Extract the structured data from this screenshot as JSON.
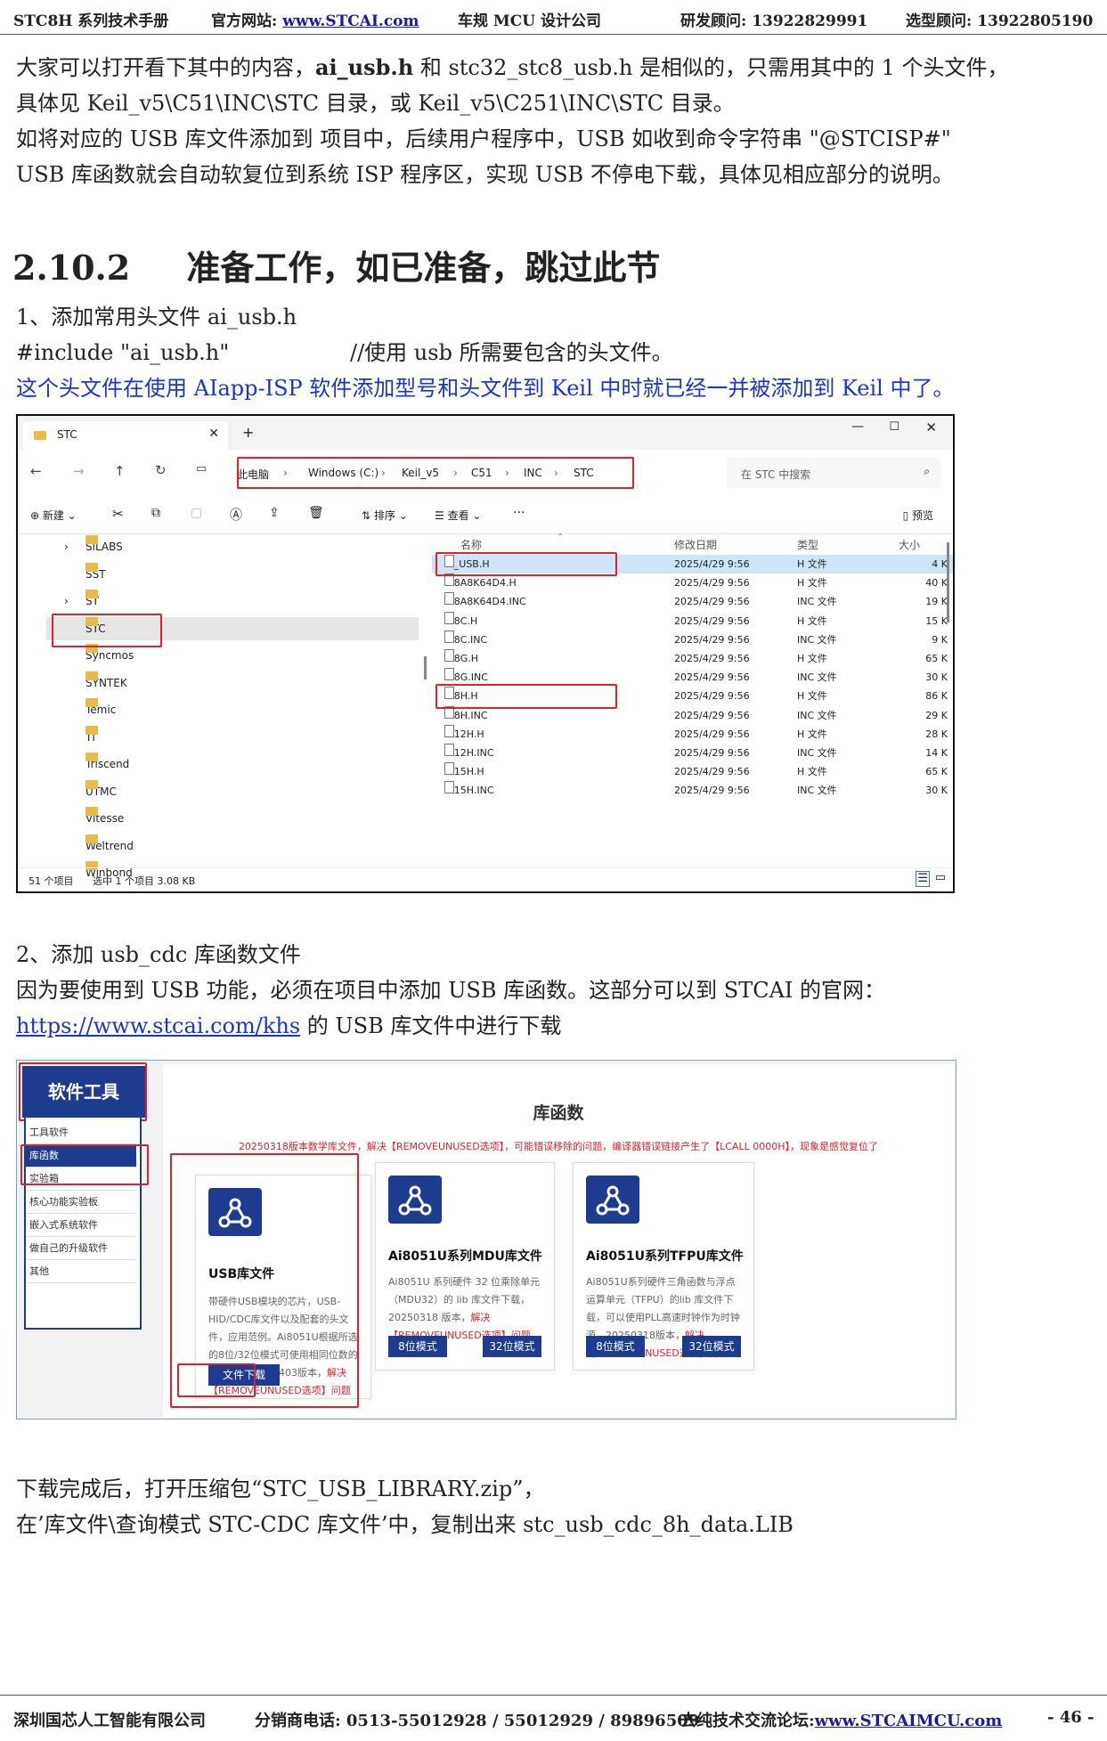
{
  "header": {
    "manual": "STC8H 系列技术手册",
    "site_label": "官方网站: ",
    "site_link": "www.STCAI.com",
    "mcu": "车规 MCU 设计公司",
    "rd_contact": "研发顾问: 13922829991",
    "sales_contact": "选型顾问: 13922805190"
  },
  "intro": {
    "line1_a": "大家可以打开看下其中的内容，",
    "line1_bold": "ai_usb.h",
    "line1_b": " 和  stc32_stc8_usb.h 是相似的，只需用其中的 1 个头文件，",
    "line2": "具体见  Keil_v5\\C51\\INC\\STC  目录，或  Keil_v5\\C251\\INC\\STC  目录。",
    "line3": "如将对应的  USB 库文件添加到  项目中，后续用户程序中，USB 如收到命令字符串  \"@STCISP#\"",
    "line4": "USB 库函数就会自动软复位到系统 ISP 程序区，实现  USB 不停电下载，具体见相应部分的说明。"
  },
  "section": {
    "number": "2.10.2",
    "title": "准备工作，如已准备，跳过此节"
  },
  "step1": {
    "title": "1、添加常用头文件 ai_usb.h",
    "code": "#include \"ai_usb.h\"",
    "comment": "//使用 usb 所需要包含的头文件。",
    "note": "这个头文件在使用 AIapp-ISP 软件添加型号和头文件到 Keil 中时就已经一并被添加到 Keil 中了。"
  },
  "explorer": {
    "tab_title": "STC",
    "new_tab": "+",
    "breadcrumb": [
      "此电脑",
      "Windows (C:)",
      "Keil_v5",
      "C51",
      "INC",
      "STC"
    ],
    "search_placeholder": "在 STC 中搜索",
    "toolbar": {
      "new": "新建",
      "sort": "排序",
      "view": "查看",
      "more": "···",
      "preview": "预览"
    },
    "sidebar": [
      "SiLABS",
      "SST",
      "ST",
      "STC",
      "Syncmos",
      "SYNTEK",
      "Temic",
      "TI",
      "Triscend",
      "UTMC",
      "Vitesse",
      "Weltrend",
      "Winbond"
    ],
    "columns": [
      "名称",
      "修改日期",
      "类型",
      "大小"
    ],
    "files": [
      {
        "name": "AI_USB.H",
        "date": "2025/4/29 9:56",
        "type": "H 文件",
        "size": "4 K"
      },
      {
        "name": "AI8A8K64D4.H",
        "date": "2025/4/29 9:56",
        "type": "H 文件",
        "size": "40 K"
      },
      {
        "name": "AI8A8K64D4.INC",
        "date": "2025/4/29 9:56",
        "type": "INC 文件",
        "size": "19 K"
      },
      {
        "name": "AI8C.H",
        "date": "2025/4/29 9:56",
        "type": "H 文件",
        "size": "15 K"
      },
      {
        "name": "AI8C.INC",
        "date": "2025/4/29 9:56",
        "type": "INC 文件",
        "size": "9 K"
      },
      {
        "name": "AI8G.H",
        "date": "2025/4/29 9:56",
        "type": "H 文件",
        "size": "65 K"
      },
      {
        "name": "AI8G.INC",
        "date": "2025/4/29 9:56",
        "type": "INC 文件",
        "size": "30 K"
      },
      {
        "name": "AI8H.H",
        "date": "2025/4/29 9:56",
        "type": "H 文件",
        "size": "86 K"
      },
      {
        "name": "AI8H.INC",
        "date": "2025/4/29 9:56",
        "type": "INC 文件",
        "size": "29 K"
      },
      {
        "name": "AI12H.H",
        "date": "2025/4/29 9:56",
        "type": "H 文件",
        "size": "28 K"
      },
      {
        "name": "AI12H.INC",
        "date": "2025/4/29 9:56",
        "type": "INC 文件",
        "size": "14 K"
      },
      {
        "name": "AI15H.H",
        "date": "2025/4/29 9:56",
        "type": "H 文件",
        "size": "65 K"
      },
      {
        "name": "AI15H.INC",
        "date": "2025/4/29 9:56",
        "type": "INC 文件",
        "size": "30 K"
      }
    ],
    "status_count": "51 个项目",
    "status_selected": "选中 1 个项目  3.08 KB"
  },
  "step2": {
    "title": "2、添加 usb_cdc 库函数文件",
    "line1": "因为要使用到 USB 功能，必须在项目中添加 USB 库函数。这部分可以到 STCAI 的官网：",
    "link": "https://www.stcai.com/khs",
    "line2_rest": " 的 USB 库文件中进行下载"
  },
  "website": {
    "sidebar_title": "软件工具",
    "sidebar_items": [
      "工具软件",
      "库函数",
      "实验箱",
      "核心功能实验板",
      "嵌入式系统软件",
      "做自己的升级软件",
      "其他"
    ],
    "heading": "库函数",
    "notice": "20250318版本数学库文件，解决【REMOVEUNUSED选项】，可能错误移除的问题，编译器错误链接产生了【LCALL  0000H】，现象是感觉复位了",
    "cards": [
      {
        "title": "USB库文件",
        "text": "带硬件USB模块的芯片，USB-HID/CDC库文件以及配套的头文件，应用范例。Ai8051U根据所选的8位/32位模式可使用相同位数的库文件，20250403版本，",
        "text_red": "解决【REMOVEUNUSED选项】问题",
        "button": "文件下载"
      },
      {
        "title": "Ai8051U系列MDU库文件",
        "text": "Ai8051U 系列硬件 32 位乘除单元（MDU32）的 lib 库文件下载，20250318 版本，",
        "text_red": "解决【REMOVEUNUSED选项】问题",
        "btn1": "8位模式",
        "btn2": "32位模式"
      },
      {
        "title": "Ai8051U系列TFPU库文件",
        "text": "Ai8051U系列硬件三角函数与浮点运算单元（TFPU）的lib 库文件下载，可以使用PLL高速时钟作为时钟源，20250318版本，",
        "text_red": "解决【REMOVEUNUSED选项】问题",
        "btn1": "8位模式",
        "btn2": "32位模式"
      }
    ]
  },
  "after": {
    "line1": "下载完成后，打开压缩包“STC_USB_LIBRARY.zip”，",
    "line2": "在’库文件\\查询模式 STC-CDC 库文件’中，复制出来 stc_usb_cdc_8h_data.LIB"
  },
  "footer": {
    "company": "深圳国芯人工智能有限公司",
    "phone": "分销商电话: 0513-55012928 / 55012929 / 89896509",
    "forum_label": "去纯技术交流论坛:",
    "forum_link": "www.STCAIMCU.com",
    "page": "- 46 -"
  }
}
